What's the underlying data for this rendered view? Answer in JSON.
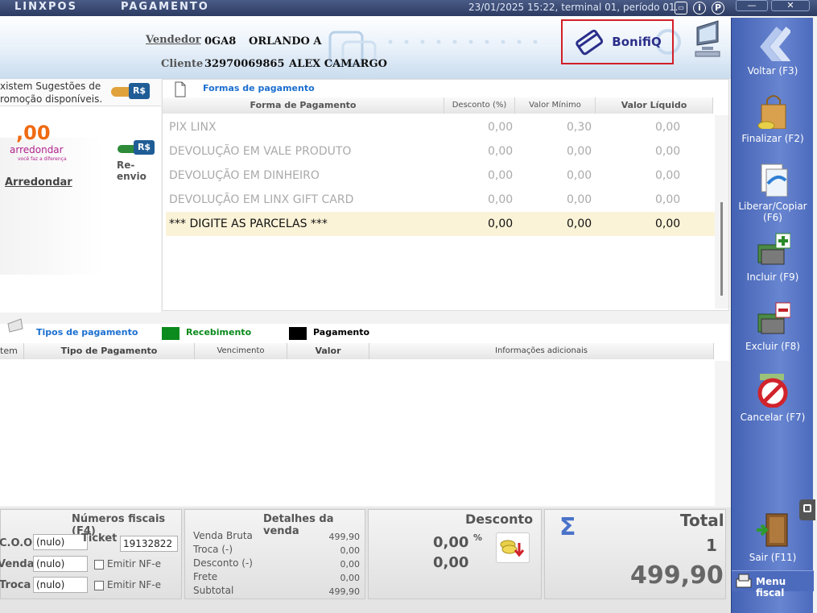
{
  "titlebar": {
    "brand": "LINXPOS",
    "section": "PAGAMENTO",
    "status": "23/01/2025 15:22, terminal 01, período 01."
  },
  "header": {
    "vendedor_label": "Vendedor",
    "vendedor_code": "0GA8",
    "vendedor_name": "ORLANDO A",
    "cliente_label": "Cliente",
    "cliente_code": "32970069865",
    "cliente_name": "ALEX CAMARGO",
    "bonifiq": "BonifiQ"
  },
  "left": {
    "sugestoes_line1": "xistem Sugestões de",
    "sugestoes_line2": "romoção disponíveis.",
    "rs_badge": "R$",
    "arredondar_value": ",00",
    "arredondar_logo": "arredondar",
    "arredondar_tagline": "você faz a diferença",
    "arredondar_label": "Arredondar",
    "reenvio_label": "Re-envio"
  },
  "formas": {
    "title": "Formas de pagamento",
    "columns": [
      "Forma de Pagamento",
      "Desconto (%)",
      "Valor Mínimo",
      "Valor Líquido"
    ],
    "rows": [
      {
        "nome": "PIX LINX",
        "desconto": "0,00",
        "minimo": "0,30",
        "liquido": "0,00"
      },
      {
        "nome": "DEVOLUÇÃO EM VALE PRODUTO",
        "desconto": "0,00",
        "minimo": "0,00",
        "liquido": "0,00"
      },
      {
        "nome": "DEVOLUÇÃO EM DINHEIRO",
        "desconto": "0,00",
        "minimo": "0,00",
        "liquido": "0,00"
      },
      {
        "nome": "DEVOLUÇÃO EM LINX GIFT CARD",
        "desconto": "0,00",
        "minimo": "0,00",
        "liquido": "0,00"
      },
      {
        "nome": "*** DIGITE AS PARCELAS ***",
        "desconto": "0,00",
        "minimo": "0,00",
        "liquido": "0,00"
      }
    ]
  },
  "tipos": {
    "title": "Tipos de pagamento",
    "legend_recebimento": "Recebimento",
    "legend_pagamento": "Pagamento",
    "columns": [
      "tem",
      "Tipo de Pagamento",
      "Vencimento",
      "Valor",
      "Informações adicionais"
    ]
  },
  "fiscais": {
    "title": "Números fiscais (F4)",
    "coo_label": "C.O.O.",
    "coo_value": "(nulo)",
    "ticket_label": "Ticket",
    "ticket_value": "19132822",
    "venda_label": "Venda",
    "venda_value": "(nulo)",
    "troca_label": "Troca",
    "troca_value": "(nulo)",
    "emitir1": "Emitir NF-e",
    "emitir2": "Emitir NF-e"
  },
  "detalhes": {
    "title": "Detalhes da venda",
    "rows": [
      {
        "label": "Venda Bruta",
        "value": "499,90"
      },
      {
        "label": "Troca (-)",
        "value": "0,00"
      },
      {
        "label": "Desconto (-)",
        "value": "0,00"
      },
      {
        "label": "Frete",
        "value": "0,00"
      },
      {
        "label": "Subtotal",
        "value": "499,90"
      }
    ]
  },
  "desconto": {
    "title": "Desconto",
    "percent": "0,00",
    "percent_sign": "%",
    "value": "0,00"
  },
  "total": {
    "title": "Total",
    "count": "1",
    "value": "499,90"
  },
  "sidebar": {
    "voltar": "Voltar (F3)",
    "finalizar": "Finalizar (F2)",
    "liberar": "Liberar/Copiar",
    "liberar_key": "(F6)",
    "incluir": "Incluir (F9)",
    "excluir": "Excluir (F8)",
    "cancelar": "Cancelar (F7)",
    "sair": "Sair (F11)",
    "menu_fiscal": "Menu fiscal"
  },
  "colors": {
    "accent": "#1c6fd0",
    "sidebar": "#5574c6",
    "recebimento": "#0b8a1d",
    "pagamento": "#000000",
    "bonifiq_border": "#d21f26"
  }
}
